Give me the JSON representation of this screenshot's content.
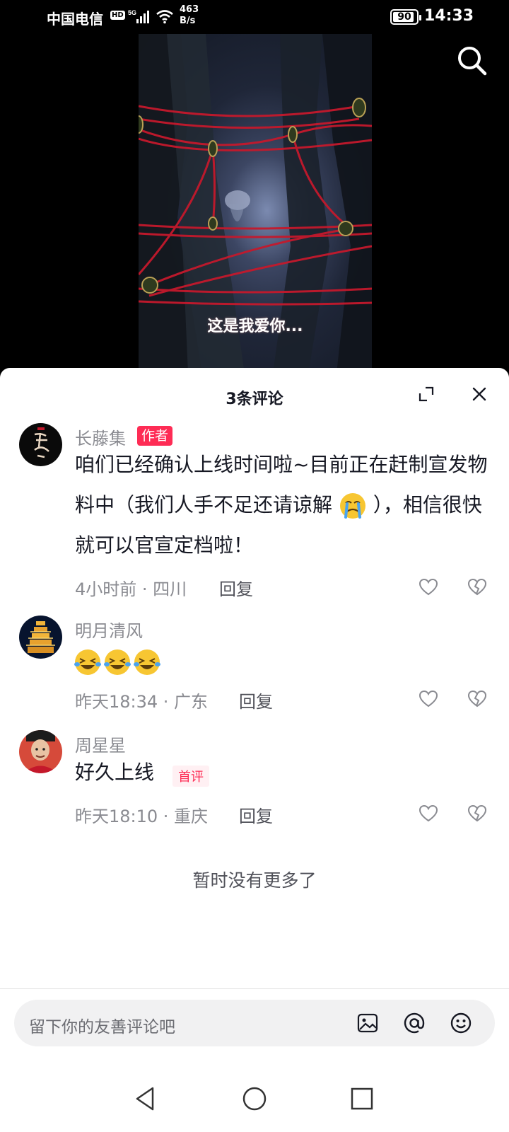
{
  "status_bar": {
    "carrier": "中国电信",
    "hd": "HD",
    "net_speed_value": "463",
    "net_speed_unit": "B/s",
    "battery": "90",
    "battery_level": 0.9,
    "time": "14:33"
  },
  "video": {
    "subtitle": "这是我爱你..."
  },
  "comments_panel": {
    "title": "3条评论",
    "comments": [
      {
        "username": "长藤集",
        "author_tag": "作者",
        "text": "咱们已经确认上线时间啦~目前正在赶制宣发物料中（我们人手不足还请谅解",
        "text_tail": "），相信很快就可以官宣定档啦！",
        "inline_emoji": "crying-face",
        "time_location": "4小时前 · 四川",
        "reply_label": "回复"
      },
      {
        "username": "明月清风",
        "emojis": [
          "laughing-crying-face",
          "laughing-crying-face",
          "laughing-crying-face"
        ],
        "time_location": "昨天18:34 · 广东",
        "reply_label": "回复"
      },
      {
        "username": "周星星",
        "text": "好久上线",
        "first_tag": "首评",
        "time_location": "昨天18:10 · 重庆",
        "reply_label": "回复"
      }
    ],
    "no_more": "暂时没有更多了"
  },
  "input_bar": {
    "placeholder": "留下你的友善评论吧"
  },
  "icons": {
    "search": "search-icon",
    "expand": "expand-icon",
    "close": "close-icon",
    "like": "heart-icon",
    "dislike": "broken-heart-icon",
    "image": "image-icon",
    "mention": "at-icon",
    "emoji": "emoji-icon",
    "nav_back": "triangle-back-icon",
    "nav_home": "circle-home-icon",
    "nav_recent": "square-recent-icon"
  },
  "colors": {
    "accent": "#fe2c55",
    "text_primary": "#161823",
    "text_secondary": "#8a8b91"
  }
}
